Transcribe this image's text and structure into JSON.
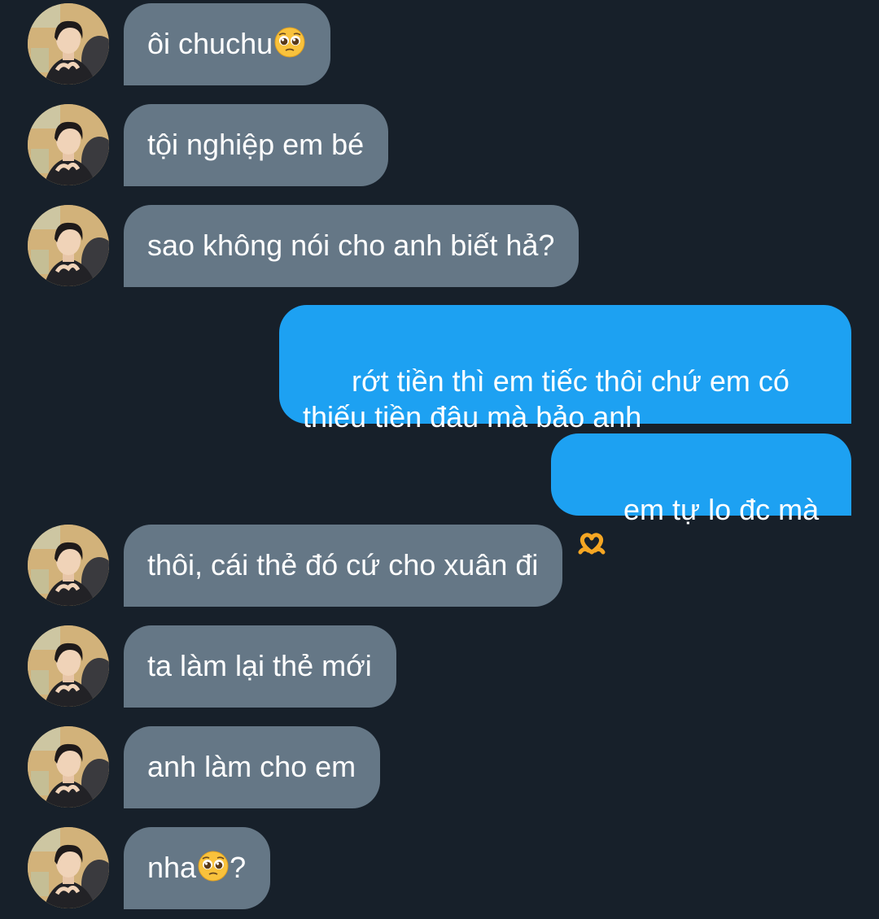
{
  "messages": [
    {
      "side": "in",
      "text": "ôi chuchu",
      "emoji": "pleading-face-emoji",
      "suffix": ""
    },
    {
      "side": "in",
      "text": "tội nghiệp em bé",
      "emoji": "",
      "suffix": ""
    },
    {
      "side": "in",
      "text": "sao không nói cho anh biết hả?",
      "emoji": "",
      "suffix": ""
    },
    {
      "side": "out",
      "text": "rớt tiền thì em tiếc thôi chứ em có\nthiếu tiền đâu mà bảo anh",
      "emoji": "",
      "suffix": ""
    },
    {
      "side": "out",
      "text": "em tự lo đc mà",
      "emoji": "heart-hands-emoji",
      "suffix": ""
    },
    {
      "side": "in",
      "text": "thôi, cái thẻ đó cứ cho xuân đi",
      "emoji": "",
      "suffix": ""
    },
    {
      "side": "in",
      "text": "ta làm lại thẻ mới",
      "emoji": "",
      "suffix": ""
    },
    {
      "side": "in",
      "text": "anh làm cho em",
      "emoji": "",
      "suffix": ""
    },
    {
      "side": "in",
      "text": "nha",
      "emoji": "pleading-face-emoji",
      "suffix": "?"
    }
  ],
  "colors": {
    "background": "#17202a",
    "incoming_bubble": "#657786",
    "outgoing_bubble": "#1da1f2",
    "text": "#ffffff"
  },
  "avatar_icon": "avatar-photo-icon"
}
